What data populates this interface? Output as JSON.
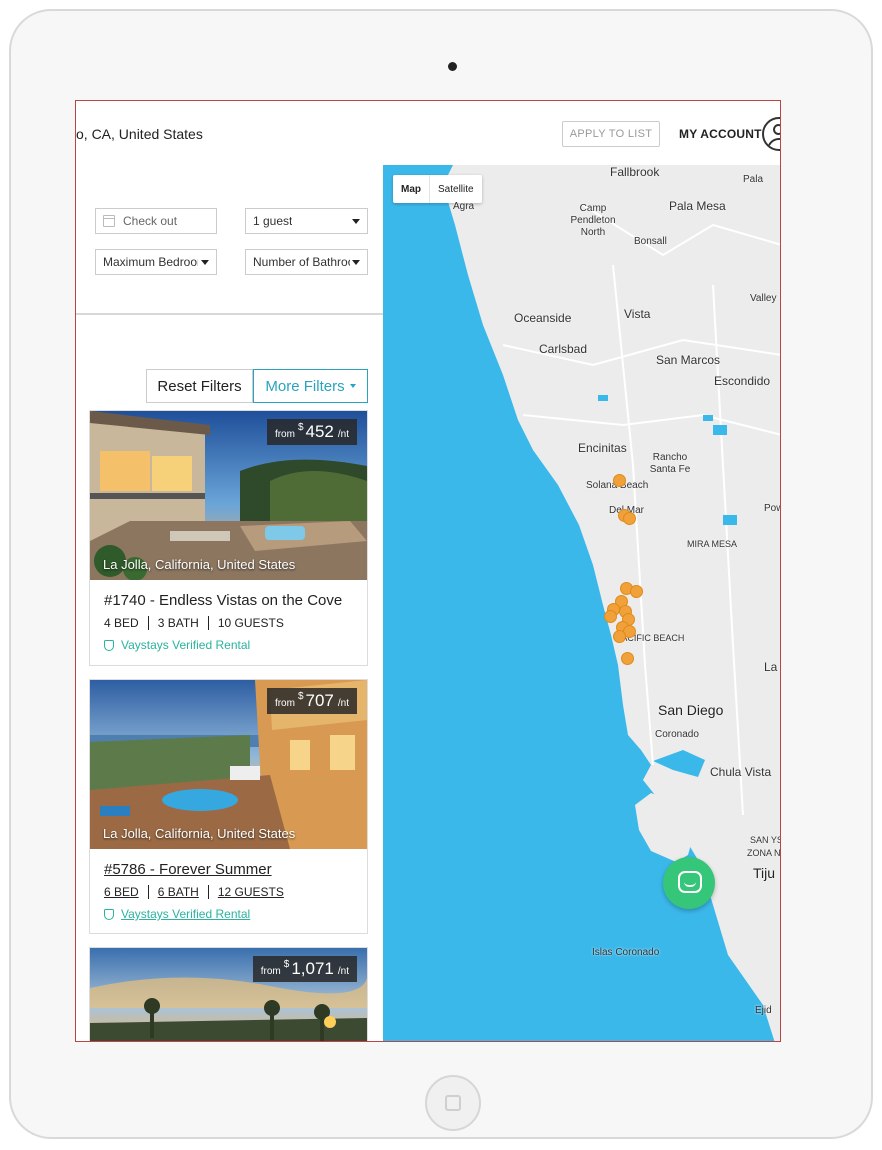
{
  "header": {
    "location_text": "o, CA, United States",
    "apply_label": "APPLY TO LIST",
    "account_label": "MY ACCOUNT"
  },
  "filters": {
    "checkout_placeholder": "Check out",
    "guests_value": "1 guest",
    "bedrooms_value": "Maximum Bedrooms",
    "bathrooms_value": "Number of Bathrooms",
    "reset_label": "Reset Filters",
    "more_label": "More Filters"
  },
  "listings": [
    {
      "price_from": "from",
      "currency": "$",
      "price": "452",
      "per": "/nt",
      "location": "La Jolla, California, United States",
      "title": "#1740 - Endless Vistas on the Cove",
      "beds": "4 BED",
      "baths": "3 BATH",
      "guests": "10 GUESTS",
      "verified": "Vaystays Verified Rental"
    },
    {
      "price_from": "from",
      "currency": "$",
      "price": "707",
      "per": "/nt",
      "location": "La Jolla, California, United States",
      "title": "#5786 - Forever Summer",
      "beds": "6 BED",
      "baths": "6 BATH",
      "guests": "12 GUESTS",
      "verified": "Vaystays Verified Rental"
    },
    {
      "price_from": "from",
      "currency": "$",
      "price": "1,071",
      "per": "/nt"
    }
  ],
  "map": {
    "toggle_map": "Map",
    "toggle_satellite": "Satellite",
    "labels": {
      "fallbrook": "Fallbrook",
      "pala": "Pala",
      "agra": "Agra",
      "camp_pendleton": "Camp Pendleton North",
      "pala_mesa": "Pala Mesa",
      "bonsall": "Bonsall",
      "valley": "Valley",
      "oceanside": "Oceanside",
      "vista": "Vista",
      "carlsbad": "Carlsbad",
      "san_marcos": "San Marcos",
      "escondido": "Escondido",
      "encinitas": "Encinitas",
      "rancho_santa_fe": "Rancho Santa Fe",
      "solana_beach": "Solana Beach",
      "del_mar": "Del Mar",
      "pow": "Pow",
      "mira_mesa": "MIRA MESA",
      "pacific_beach": "PACIFIC BEACH",
      "la": "La",
      "san_diego": "San Diego",
      "coronado": "Coronado",
      "chula_vista": "Chula Vista",
      "san_ysidro": "SAN YSI",
      "zona_norte": "ZONA NO",
      "tijuana": "Tiju",
      "islas_coronado": "Islas Coronado",
      "ejido": "Ejid"
    }
  },
  "colors": {
    "accent": "#2aa3bf",
    "verified": "#2ab39e",
    "water": "#3bb8ea",
    "pin": "#f1a13a",
    "chat": "#35c67a"
  }
}
